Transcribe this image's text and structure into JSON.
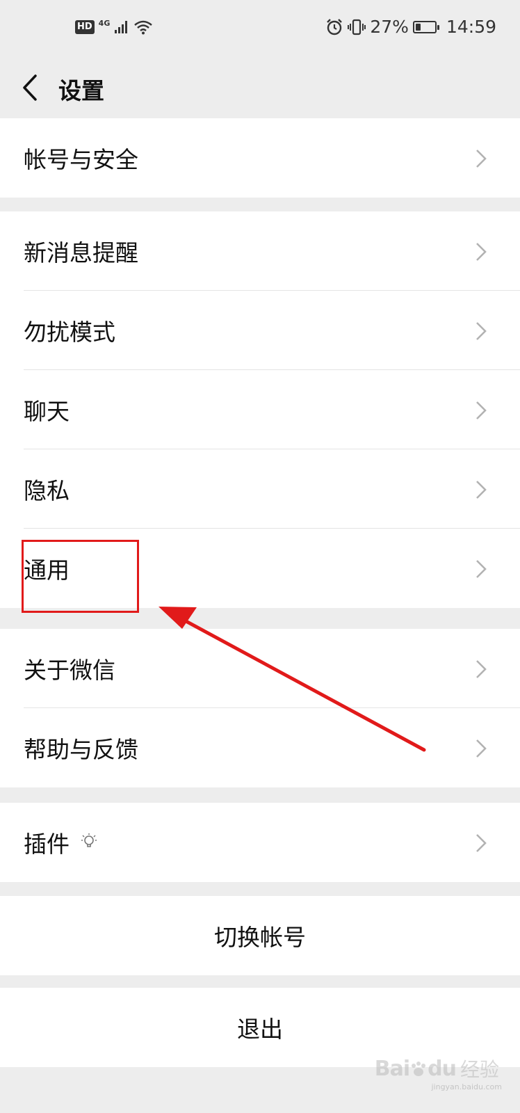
{
  "status_bar": {
    "hd": "HD",
    "network": "4G",
    "battery_percent": "27%",
    "battery_level": 0.27,
    "time": "14:59",
    "icons": [
      "signal-icon",
      "wifi-icon",
      "alarm-icon",
      "vibrate-icon",
      "battery-icon"
    ]
  },
  "nav": {
    "back_icon": "chevron-left-icon",
    "title": "设置"
  },
  "settings": {
    "account_security": "帐号与安全",
    "new_message_alert": "新消息提醒",
    "do_not_disturb": "勿扰模式",
    "chat": "聊天",
    "privacy": "隐私",
    "general": "通用",
    "about_wechat": "关于微信",
    "help_feedback": "帮助与反馈",
    "plugins": "插件",
    "plugins_badge_icon": "lightbulb-icon",
    "switch_account": "切换帐号",
    "logout": "退出"
  },
  "annotation": {
    "color": "#e11a1a",
    "target": "通用"
  },
  "watermark": {
    "logo": "Bai",
    "logo_suffix": "du",
    "sub": "经验",
    "url": "jingyan.baidu.com"
  }
}
